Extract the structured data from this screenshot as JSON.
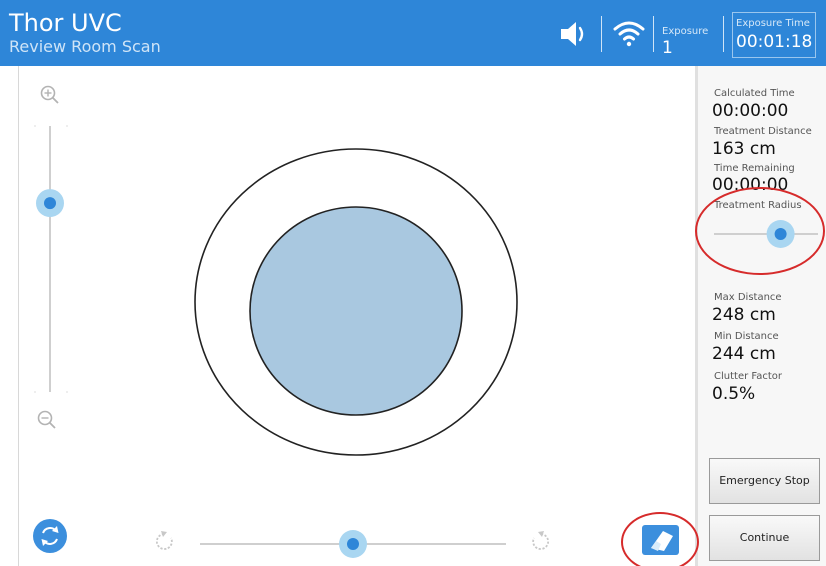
{
  "header": {
    "title": "Thor UVC",
    "subtitle": "Review Room Scan",
    "exposure_label": "Exposure",
    "exposure_value": "1",
    "exposure_time_label": "Exposure Time",
    "exposure_time_value": "00:01:18",
    "icons": [
      "speaker-icon",
      "wifi-icon"
    ]
  },
  "stats": {
    "calculated_time_label": "Calculated Time",
    "calculated_time_value": "00:00:00",
    "treatment_distance_label": "Treatment Distance",
    "treatment_distance_value": "163 cm",
    "time_remaining_label": "Time Remaining",
    "time_remaining_value": "00:00:00",
    "treatment_radius_label": "Treatment Radius",
    "treatment_radius_level": 0.64,
    "max_distance_label": "Max Distance",
    "max_distance_value": "248 cm",
    "min_distance_label": "Min Distance",
    "min_distance_value": "244 cm",
    "clutter_factor_label": "Clutter Factor",
    "clutter_factor_value": "0.5%"
  },
  "buttons": {
    "emergency_stop": "Emergency Stop",
    "continue": "Continue"
  },
  "controls": {
    "zoom_level": 0.71,
    "rotation_level": 0.5
  },
  "colors": {
    "header": "#2e86d8",
    "accent": "#2e86d8",
    "knob_halo": "#a9d6f1",
    "inner_circle": "#a9c8e0",
    "annotation": "#d62b2b"
  }
}
